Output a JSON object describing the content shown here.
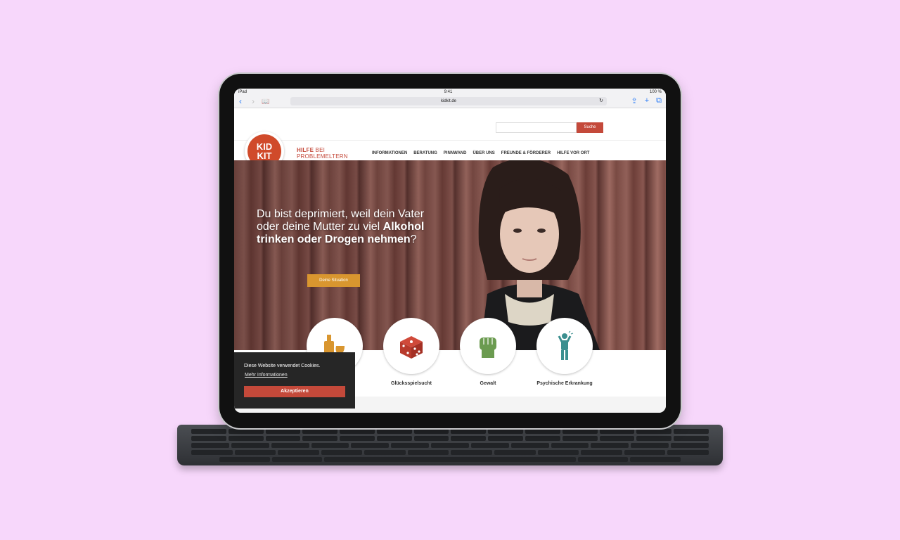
{
  "device": {
    "status_left": "iPad",
    "status_time": "9:41",
    "status_battery": "100 %",
    "url": "kidkit.de"
  },
  "site": {
    "search_button": "Suche",
    "logo_line1": "KID",
    "logo_line2": "KIT",
    "tagline_bold": "HILFE",
    "tagline_rest": " BEI",
    "tagline_line2": "PROBLEMELTERN",
    "menu": [
      "INFORMATIONEN",
      "BERATUNG",
      "PINNWAND",
      "ÜBER UNS",
      "FREUNDE & FÖRDERER",
      "HILFE VOR ORT"
    ],
    "hero": {
      "line1": "Du bist deprimiert, weil dein Vater",
      "line2_plain": "oder deine Mutter zu viel ",
      "line2_bold": "Alkohol",
      "line3_bold": "trinken oder Drogen nehmen",
      "line3_end": "?",
      "button": "Deine Situation"
    },
    "cards": [
      {
        "label": "",
        "icon": "bottle-glass-icon"
      },
      {
        "label": "Glücksspielsucht",
        "icon": "dice-icon"
      },
      {
        "label": "Gewalt",
        "icon": "fist-icon"
      },
      {
        "label": "Psychische Erkrankung",
        "icon": "distressed-person-icon"
      }
    ],
    "cookie": {
      "text": "Diese Website verwendet Cookies.",
      "link": "Mehr Informationen",
      "button": "Akzeptieren"
    }
  },
  "colors": {
    "background": "#f7d7fb",
    "brand_red": "#c4493a",
    "accent_orange": "#d9962f"
  }
}
